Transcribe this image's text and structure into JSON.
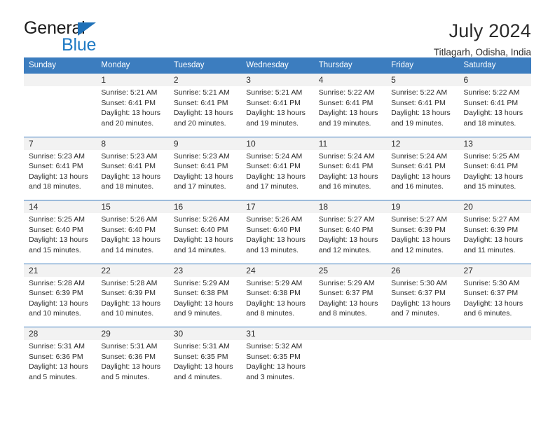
{
  "brand": {
    "name_part1": "General",
    "name_part2": "Blue",
    "accent_color": "#1f7ac4",
    "header_color": "#3c7dbf"
  },
  "header": {
    "title": "July 2024",
    "subtitle": "Titlagarh, Odisha, India"
  },
  "calendar": {
    "weekday_headers": [
      "Sunday",
      "Monday",
      "Tuesday",
      "Wednesday",
      "Thursday",
      "Friday",
      "Saturday"
    ],
    "weeks": [
      {
        "days": [
          {
            "date": "",
            "sunrise": "",
            "sunset": "",
            "daylight_line1": "",
            "daylight_line2": "",
            "empty": true
          },
          {
            "date": "1",
            "sunrise": "Sunrise: 5:21 AM",
            "sunset": "Sunset: 6:41 PM",
            "daylight_line1": "Daylight: 13 hours",
            "daylight_line2": "and 20 minutes."
          },
          {
            "date": "2",
            "sunrise": "Sunrise: 5:21 AM",
            "sunset": "Sunset: 6:41 PM",
            "daylight_line1": "Daylight: 13 hours",
            "daylight_line2": "and 20 minutes."
          },
          {
            "date": "3",
            "sunrise": "Sunrise: 5:21 AM",
            "sunset": "Sunset: 6:41 PM",
            "daylight_line1": "Daylight: 13 hours",
            "daylight_line2": "and 19 minutes."
          },
          {
            "date": "4",
            "sunrise": "Sunrise: 5:22 AM",
            "sunset": "Sunset: 6:41 PM",
            "daylight_line1": "Daylight: 13 hours",
            "daylight_line2": "and 19 minutes."
          },
          {
            "date": "5",
            "sunrise": "Sunrise: 5:22 AM",
            "sunset": "Sunset: 6:41 PM",
            "daylight_line1": "Daylight: 13 hours",
            "daylight_line2": "and 19 minutes."
          },
          {
            "date": "6",
            "sunrise": "Sunrise: 5:22 AM",
            "sunset": "Sunset: 6:41 PM",
            "daylight_line1": "Daylight: 13 hours",
            "daylight_line2": "and 18 minutes."
          }
        ]
      },
      {
        "days": [
          {
            "date": "7",
            "sunrise": "Sunrise: 5:23 AM",
            "sunset": "Sunset: 6:41 PM",
            "daylight_line1": "Daylight: 13 hours",
            "daylight_line2": "and 18 minutes."
          },
          {
            "date": "8",
            "sunrise": "Sunrise: 5:23 AM",
            "sunset": "Sunset: 6:41 PM",
            "daylight_line1": "Daylight: 13 hours",
            "daylight_line2": "and 18 minutes."
          },
          {
            "date": "9",
            "sunrise": "Sunrise: 5:23 AM",
            "sunset": "Sunset: 6:41 PM",
            "daylight_line1": "Daylight: 13 hours",
            "daylight_line2": "and 17 minutes."
          },
          {
            "date": "10",
            "sunrise": "Sunrise: 5:24 AM",
            "sunset": "Sunset: 6:41 PM",
            "daylight_line1": "Daylight: 13 hours",
            "daylight_line2": "and 17 minutes."
          },
          {
            "date": "11",
            "sunrise": "Sunrise: 5:24 AM",
            "sunset": "Sunset: 6:41 PM",
            "daylight_line1": "Daylight: 13 hours",
            "daylight_line2": "and 16 minutes."
          },
          {
            "date": "12",
            "sunrise": "Sunrise: 5:24 AM",
            "sunset": "Sunset: 6:41 PM",
            "daylight_line1": "Daylight: 13 hours",
            "daylight_line2": "and 16 minutes."
          },
          {
            "date": "13",
            "sunrise": "Sunrise: 5:25 AM",
            "sunset": "Sunset: 6:41 PM",
            "daylight_line1": "Daylight: 13 hours",
            "daylight_line2": "and 15 minutes."
          }
        ]
      },
      {
        "days": [
          {
            "date": "14",
            "sunrise": "Sunrise: 5:25 AM",
            "sunset": "Sunset: 6:40 PM",
            "daylight_line1": "Daylight: 13 hours",
            "daylight_line2": "and 15 minutes."
          },
          {
            "date": "15",
            "sunrise": "Sunrise: 5:26 AM",
            "sunset": "Sunset: 6:40 PM",
            "daylight_line1": "Daylight: 13 hours",
            "daylight_line2": "and 14 minutes."
          },
          {
            "date": "16",
            "sunrise": "Sunrise: 5:26 AM",
            "sunset": "Sunset: 6:40 PM",
            "daylight_line1": "Daylight: 13 hours",
            "daylight_line2": "and 14 minutes."
          },
          {
            "date": "17",
            "sunrise": "Sunrise: 5:26 AM",
            "sunset": "Sunset: 6:40 PM",
            "daylight_line1": "Daylight: 13 hours",
            "daylight_line2": "and 13 minutes."
          },
          {
            "date": "18",
            "sunrise": "Sunrise: 5:27 AM",
            "sunset": "Sunset: 6:40 PM",
            "daylight_line1": "Daylight: 13 hours",
            "daylight_line2": "and 12 minutes."
          },
          {
            "date": "19",
            "sunrise": "Sunrise: 5:27 AM",
            "sunset": "Sunset: 6:39 PM",
            "daylight_line1": "Daylight: 13 hours",
            "daylight_line2": "and 12 minutes."
          },
          {
            "date": "20",
            "sunrise": "Sunrise: 5:27 AM",
            "sunset": "Sunset: 6:39 PM",
            "daylight_line1": "Daylight: 13 hours",
            "daylight_line2": "and 11 minutes."
          }
        ]
      },
      {
        "days": [
          {
            "date": "21",
            "sunrise": "Sunrise: 5:28 AM",
            "sunset": "Sunset: 6:39 PM",
            "daylight_line1": "Daylight: 13 hours",
            "daylight_line2": "and 10 minutes."
          },
          {
            "date": "22",
            "sunrise": "Sunrise: 5:28 AM",
            "sunset": "Sunset: 6:39 PM",
            "daylight_line1": "Daylight: 13 hours",
            "daylight_line2": "and 10 minutes."
          },
          {
            "date": "23",
            "sunrise": "Sunrise: 5:29 AM",
            "sunset": "Sunset: 6:38 PM",
            "daylight_line1": "Daylight: 13 hours",
            "daylight_line2": "and 9 minutes."
          },
          {
            "date": "24",
            "sunrise": "Sunrise: 5:29 AM",
            "sunset": "Sunset: 6:38 PM",
            "daylight_line1": "Daylight: 13 hours",
            "daylight_line2": "and 8 minutes."
          },
          {
            "date": "25",
            "sunrise": "Sunrise: 5:29 AM",
            "sunset": "Sunset: 6:37 PM",
            "daylight_line1": "Daylight: 13 hours",
            "daylight_line2": "and 8 minutes."
          },
          {
            "date": "26",
            "sunrise": "Sunrise: 5:30 AM",
            "sunset": "Sunset: 6:37 PM",
            "daylight_line1": "Daylight: 13 hours",
            "daylight_line2": "and 7 minutes."
          },
          {
            "date": "27",
            "sunrise": "Sunrise: 5:30 AM",
            "sunset": "Sunset: 6:37 PM",
            "daylight_line1": "Daylight: 13 hours",
            "daylight_line2": "and 6 minutes."
          }
        ]
      },
      {
        "days": [
          {
            "date": "28",
            "sunrise": "Sunrise: 5:31 AM",
            "sunset": "Sunset: 6:36 PM",
            "daylight_line1": "Daylight: 13 hours",
            "daylight_line2": "and 5 minutes."
          },
          {
            "date": "29",
            "sunrise": "Sunrise: 5:31 AM",
            "sunset": "Sunset: 6:36 PM",
            "daylight_line1": "Daylight: 13 hours",
            "daylight_line2": "and 5 minutes."
          },
          {
            "date": "30",
            "sunrise": "Sunrise: 5:31 AM",
            "sunset": "Sunset: 6:35 PM",
            "daylight_line1": "Daylight: 13 hours",
            "daylight_line2": "and 4 minutes."
          },
          {
            "date": "31",
            "sunrise": "Sunrise: 5:32 AM",
            "sunset": "Sunset: 6:35 PM",
            "daylight_line1": "Daylight: 13 hours",
            "daylight_line2": "and 3 minutes."
          },
          {
            "date": "",
            "sunrise": "",
            "sunset": "",
            "daylight_line1": "",
            "daylight_line2": "",
            "empty": true
          },
          {
            "date": "",
            "sunrise": "",
            "sunset": "",
            "daylight_line1": "",
            "daylight_line2": "",
            "empty": true
          },
          {
            "date": "",
            "sunrise": "",
            "sunset": "",
            "daylight_line1": "",
            "daylight_line2": "",
            "empty": true
          }
        ]
      }
    ]
  }
}
